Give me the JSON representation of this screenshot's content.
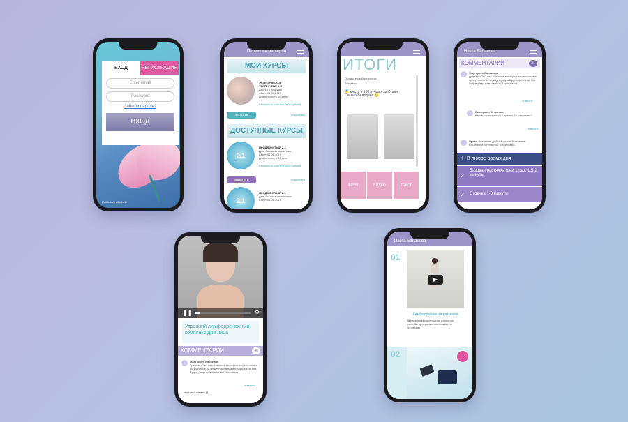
{
  "phone1": {
    "tabs": [
      "ВХОД",
      "РЕГИСТРАЦИЯ"
    ],
    "email_placeholder": "Enter email",
    "password_placeholder": "Password",
    "forgot": "Забыли пароль?",
    "login_button": "ВХОД",
    "footer": "Publicdom effects.io"
  },
  "phone2": {
    "header": "Перейти в марафон",
    "my_courses": "МОИ КУРСЫ",
    "course1": {
      "title": "ЭСТЕТИЧЕСКОЕ ТЕЙПИРОВАНИЕ",
      "l1": "Доступ к лекциям",
      "l2": "Старт 01.06.2019",
      "l3": "Длительность 20 дней",
      "price": "Стоимость участия 5000 рублей",
      "btn": "перейти",
      "more": "подробнее"
    },
    "available": "ДОСТУПНЫЕ КУРСЫ",
    "course2": {
      "badge": "2.1",
      "title": "ПРОДВИНУТЫЙ 2.1",
      "l1": "Для: базовая гимнастика",
      "l2": "Старт 01.06.2019",
      "l3": "Длительность 21 день",
      "price": "Стоимость участия 4500 рублей",
      "btn": "оплатить",
      "more": "подробнее"
    },
    "course3": {
      "badge": "2.1",
      "title": "ПРОДВИНУТЫЙ 2.1",
      "l1": "Для: базовая гимнастика",
      "l2": "Старт 01.06.2019"
    }
  },
  "phone3": {
    "title": "ИТОГИ",
    "l1": "Оставьте свой результат",
    "l2": "Все итоги",
    "l3": "🥇 место в 100 лучших за Судьи",
    "l4": "Оксана Володина 😊",
    "tabs": [
      "ФОТО",
      "ВИДЕО",
      "ТЕКСТ"
    ]
  },
  "phone4": {
    "header": "Ивета Баланова",
    "comments_title": "КОММЕНТАРИИ",
    "count": "31",
    "c1": {
      "name": "Маргарита Басакина",
      "text": "Давайте! Это лаж. Начните марафон вашего поля в присутствие на международный день фитнеса! Мы будем рады вам и вам всё получится",
      "reply": "ответить"
    },
    "c2": {
      "name": "Екатерина Бунакова",
      "text": "Какое замечательное время! Вы результат?",
      "reply": "ответить"
    },
    "c3": {
      "name": "Ирина Басакина",
      "text": "Добрый отзыв! В течение последней регулярной тренировки..."
    },
    "banner": "В любое время дня",
    "ex1": "Базовая растяжка шеи 1 раз, 1,5-2 минуты",
    "ex2": "Стоечка 1-3 минуты"
  },
  "phone5": {
    "video_title": "Утренний лимфодренажный комплекс для лица",
    "comments_title": "КОММЕНТАРИИ",
    "count": "46",
    "c1": {
      "name": "Маргарита Басакина",
      "text": "Давайте! Это лаж. Начните марафон вашего поля в присутствие на международный день фитнеса! Мы будем рады вам и вам всё получится",
      "reply": "ответить"
    },
    "see_answers": "смотреть ответы (1)"
  },
  "phone6": {
    "header": "Ивета Баланова",
    "n1": "01",
    "caption": "Лимфодренажная разминка",
    "desc": "Первая лимфодренажная разминка способствует движению лимфы по организму",
    "n2": "02"
  },
  "colors": {
    "accent_pink": "#e05aa0",
    "accent_purple": "#8f79c0",
    "accent_teal": "#4b9eb0"
  }
}
